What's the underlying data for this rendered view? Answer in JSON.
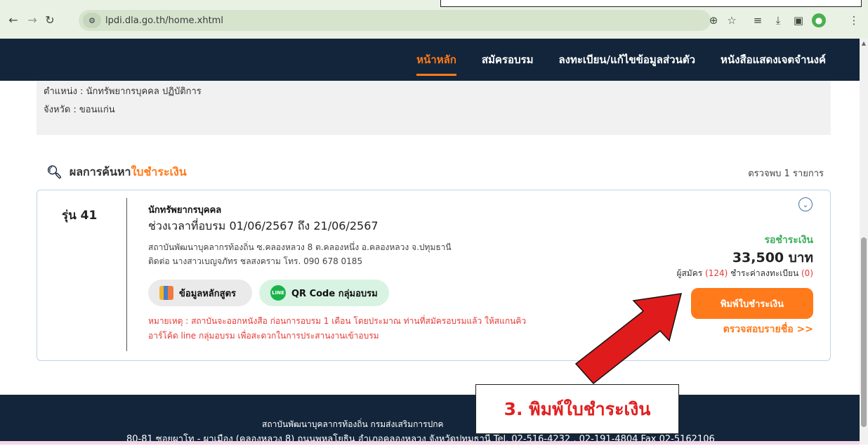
{
  "browser": {
    "url": "lpdi.dla.go.th/home.xhtml",
    "icons": [
      "back-icon",
      "forward-icon",
      "reload-icon",
      "site-info-icon",
      "zoom-icon",
      "bookmark-star-icon",
      "reading-list-icon",
      "download-icon",
      "side-panel-icon",
      "profile-icon",
      "menu-icon"
    ]
  },
  "nav": {
    "items": [
      {
        "label": "หน้าหลัก",
        "active": true
      },
      {
        "label": "สมัครอบรม",
        "active": false
      },
      {
        "label": "ลงทะเบียน/แก้ไขข้อมูลส่วนตัว",
        "active": false
      },
      {
        "label": "หนังสือแสดงเจตจำนงค์",
        "active": false
      }
    ]
  },
  "profile": {
    "position": "ตำแหน่ง : นักทรัพยากรบุคคล ปฏิบัติการ",
    "province": "จังหวัด : ขอนแก่น"
  },
  "results": {
    "title_prefix": "ผลการค้นหา",
    "title_accent": "ใบชำระเงิน",
    "count": "ตรวจพบ 1 รายการ"
  },
  "card": {
    "batch": "รุ่น 41",
    "course_type": "นักทรัพยากรบุคคล",
    "period": "ช่วงเวลาที่อบรม 01/06/2567 ถึง 21/06/2567",
    "institute": "สถาบันพัฒนาบุคลากรท้องถิ่น ซ.คลองหลวง 8 ต.คลองหนึ่ง อ.คลองหลวง จ.ปทุมธานี",
    "contact": "ติดต่อ นางสาวเบญจภัทร ชลสงคราม โทร. 090 678 0185",
    "course_info_label": "ข้อมูลหลักสูตร",
    "qr_label": "QR Code กลุ่มอบรม",
    "remark_line1": "หมายเหตุ : สถาบันจะออกหนังสือ ก่อนการอบรม 1 เดือน โดยประมาณ ท่านที่สมัครอบรมแล้ว ให้สแกนคิว",
    "remark_line2": "อาร์โค้ด line กลุ่มอบรม เพื่อสะดวกในการประสานงานเข้าอบรม",
    "status": "รอชำระเงิน",
    "price": "33,500 บาท",
    "applicants_prefix": "ผู้สมัคร ",
    "applicants_count": "(124)",
    "paid_prefix": " ชำระค่าลงทะเบียน ",
    "paid_count": "(0)",
    "print_label": "พิมพ์ใบชำระเงิน",
    "check_label": "ตรวจสอบรายชื่อ >>"
  },
  "footer": {
    "line1": "สถาบันพัฒนาบุคลากรท้องถิ่น กรมส่งเสริมการปกค",
    "line2": "80-81 ซอยผาโท - ผาเมือง (คลองหลวง 8) ถนนพหลโยธิน อำเภอคลองหลวง จังหวัดปทุมธานี Tel. 02-516-4232 , 02-191-4804 Fax 02-5162106"
  },
  "callout": {
    "text": "3. พิมพ์ใบชำระเงิน"
  },
  "colors": {
    "nav_bg": "#13253a",
    "accent": "#ff7a1a",
    "status_green": "#3cae5b",
    "remark_red": "#e53935",
    "arrow_red": "#e01b1b"
  }
}
